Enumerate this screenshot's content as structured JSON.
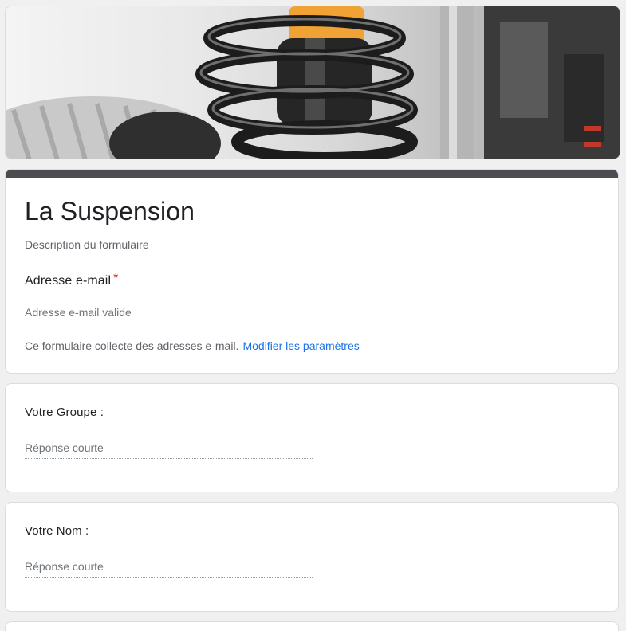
{
  "banner": {
    "image": "car-suspension-spring-header"
  },
  "form": {
    "title": "La Suspension",
    "description": "Description du formulaire",
    "theme_color": "#4b4c50"
  },
  "email_question": {
    "label": "Adresse e-mail",
    "required_mark": "*",
    "placeholder": "Adresse e-mail valide",
    "note": "Ce formulaire collecte des adresses e-mail.",
    "settings_link": "Modifier les paramètres"
  },
  "questions": [
    {
      "label": "Votre Groupe :",
      "placeholder": "Réponse courte"
    },
    {
      "label": "Votre Nom :",
      "placeholder": "Réponse courte"
    }
  ]
}
